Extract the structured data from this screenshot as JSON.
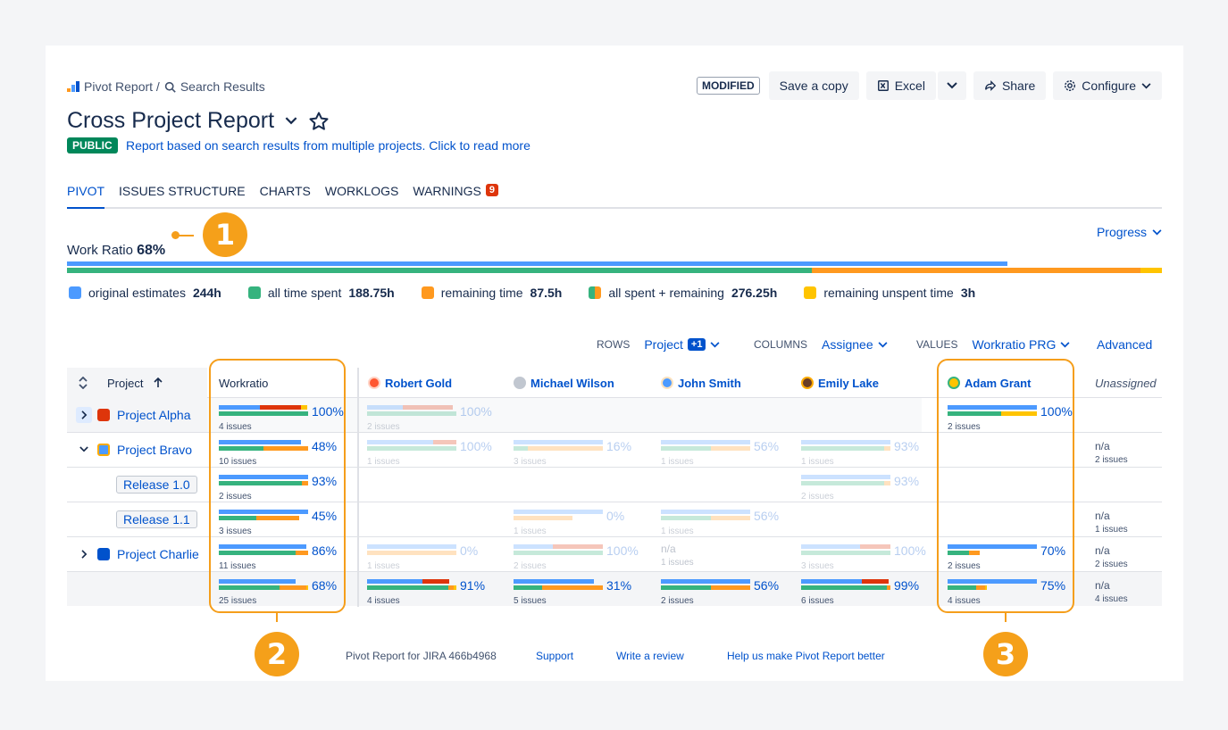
{
  "breadcrumb": {
    "root": "Pivot Report /",
    "current": "Search Results"
  },
  "header": {
    "modified": "MODIFIED",
    "save_copy": "Save a copy",
    "excel": "Excel",
    "share": "Share",
    "configure": "Configure"
  },
  "report": {
    "title": "Cross Project Report",
    "visibility": "PUBLIC",
    "description": "Report based on search results from multiple projects. Click to read more"
  },
  "tabs": [
    {
      "label": "PIVOT",
      "active": true
    },
    {
      "label": "ISSUES STRUCTURE"
    },
    {
      "label": "CHARTS"
    },
    {
      "label": "WORKLOGS"
    },
    {
      "label": "WARNINGS",
      "count": "9"
    }
  ],
  "work_ratio": {
    "label": "Work Ratio",
    "value": "68%",
    "view_selector": "Progress",
    "estimate_fraction": 0.859,
    "spent_fraction": 0.68,
    "remaining_fraction": 0.3,
    "unspent_fraction": 0.02
  },
  "legend": [
    {
      "label": "original estimates",
      "value": "244h",
      "color": "#4c9aff"
    },
    {
      "label": "all time spent",
      "value": "188.75h",
      "color": "#36b37e"
    },
    {
      "label": "remaining time",
      "value": "87.5h",
      "color": "#ff991f"
    },
    {
      "label": "all spent + remaining",
      "value": "276.25h",
      "color": "#36b37e"
    },
    {
      "label": "remaining unspent time",
      "value": "3h",
      "color": "#ffc400"
    }
  ],
  "config": {
    "rows_label": "ROWS",
    "rows_value": "Project",
    "rows_extra": "+1",
    "columns_label": "COLUMNS",
    "columns_value": "Assignee",
    "values_label": "VALUES",
    "values_value": "Workratio PRG",
    "advanced": "Advanced"
  },
  "table": {
    "project_header": "Project",
    "workratio_header": "Workratio",
    "columns": [
      "Robert Gold",
      "Michael Wilson",
      "John Smith",
      "Emily Lake",
      "Adam Grant",
      "Unassigned"
    ],
    "rows": [
      "Project Alpha",
      "Project Bravo",
      "Release 1.0",
      "Release 1.1",
      "Project Charlie"
    ],
    "workratio": [
      {
        "pct": "100%",
        "issues": "4 issues"
      },
      {
        "pct": "48%",
        "issues": "10 issues"
      },
      {
        "pct": "93%",
        "issues": "2 issues"
      },
      {
        "pct": "45%",
        "issues": "3 issues"
      },
      {
        "pct": "86%",
        "issues": "11 issues"
      },
      {
        "pct": "68%",
        "issues": "25 issues"
      }
    ],
    "robert": [
      {
        "pct": "100%",
        "issues": "2 issues"
      },
      {
        "pct": "100%",
        "issues": "1 issues"
      },
      {
        "pct": "0%",
        "issues": "1 issues"
      },
      {
        "pct": "91%",
        "issues": "4 issues"
      }
    ],
    "michael": [
      {
        "pct": "16%",
        "issues": "3 issues"
      },
      {
        "pct": "0%",
        "issues": "1 issues"
      },
      {
        "pct": "100%",
        "issues": "2 issues"
      },
      {
        "pct": "31%",
        "issues": "5 issues"
      }
    ],
    "john": [
      {
        "pct": "56%",
        "issues": "1 issues"
      },
      {
        "pct": "56%",
        "issues": "1 issues"
      },
      {
        "na": "n/a",
        "issues": "1 issues"
      },
      {
        "pct": "56%",
        "issues": "2 issues"
      }
    ],
    "emily": [
      {
        "pct": "93%",
        "issues": "1 issues"
      },
      {
        "pct": "93%",
        "issues": "2 issues"
      },
      {
        "pct": "100%",
        "issues": "3 issues"
      },
      {
        "pct": "99%",
        "issues": "6 issues"
      }
    ],
    "adam": [
      {
        "pct": "100%",
        "issues": "2 issues"
      },
      {
        "pct": "70%",
        "issues": "2 issues"
      },
      {
        "pct": "75%",
        "issues": "4 issues"
      }
    ],
    "unassigned": [
      {
        "na": "n/a",
        "issues": "2 issues"
      },
      {
        "na": "n/a",
        "issues": "1 issues"
      },
      {
        "na": "n/a",
        "issues": "2 issues"
      },
      {
        "na": "n/a",
        "issues": "4 issues"
      }
    ]
  },
  "callouts": [
    "1",
    "2",
    "3"
  ],
  "footer": {
    "product": "Pivot Report for JIRA 466b4968",
    "support": "Support",
    "review": "Write a review",
    "feedback": "Help us make Pivot Report better"
  }
}
